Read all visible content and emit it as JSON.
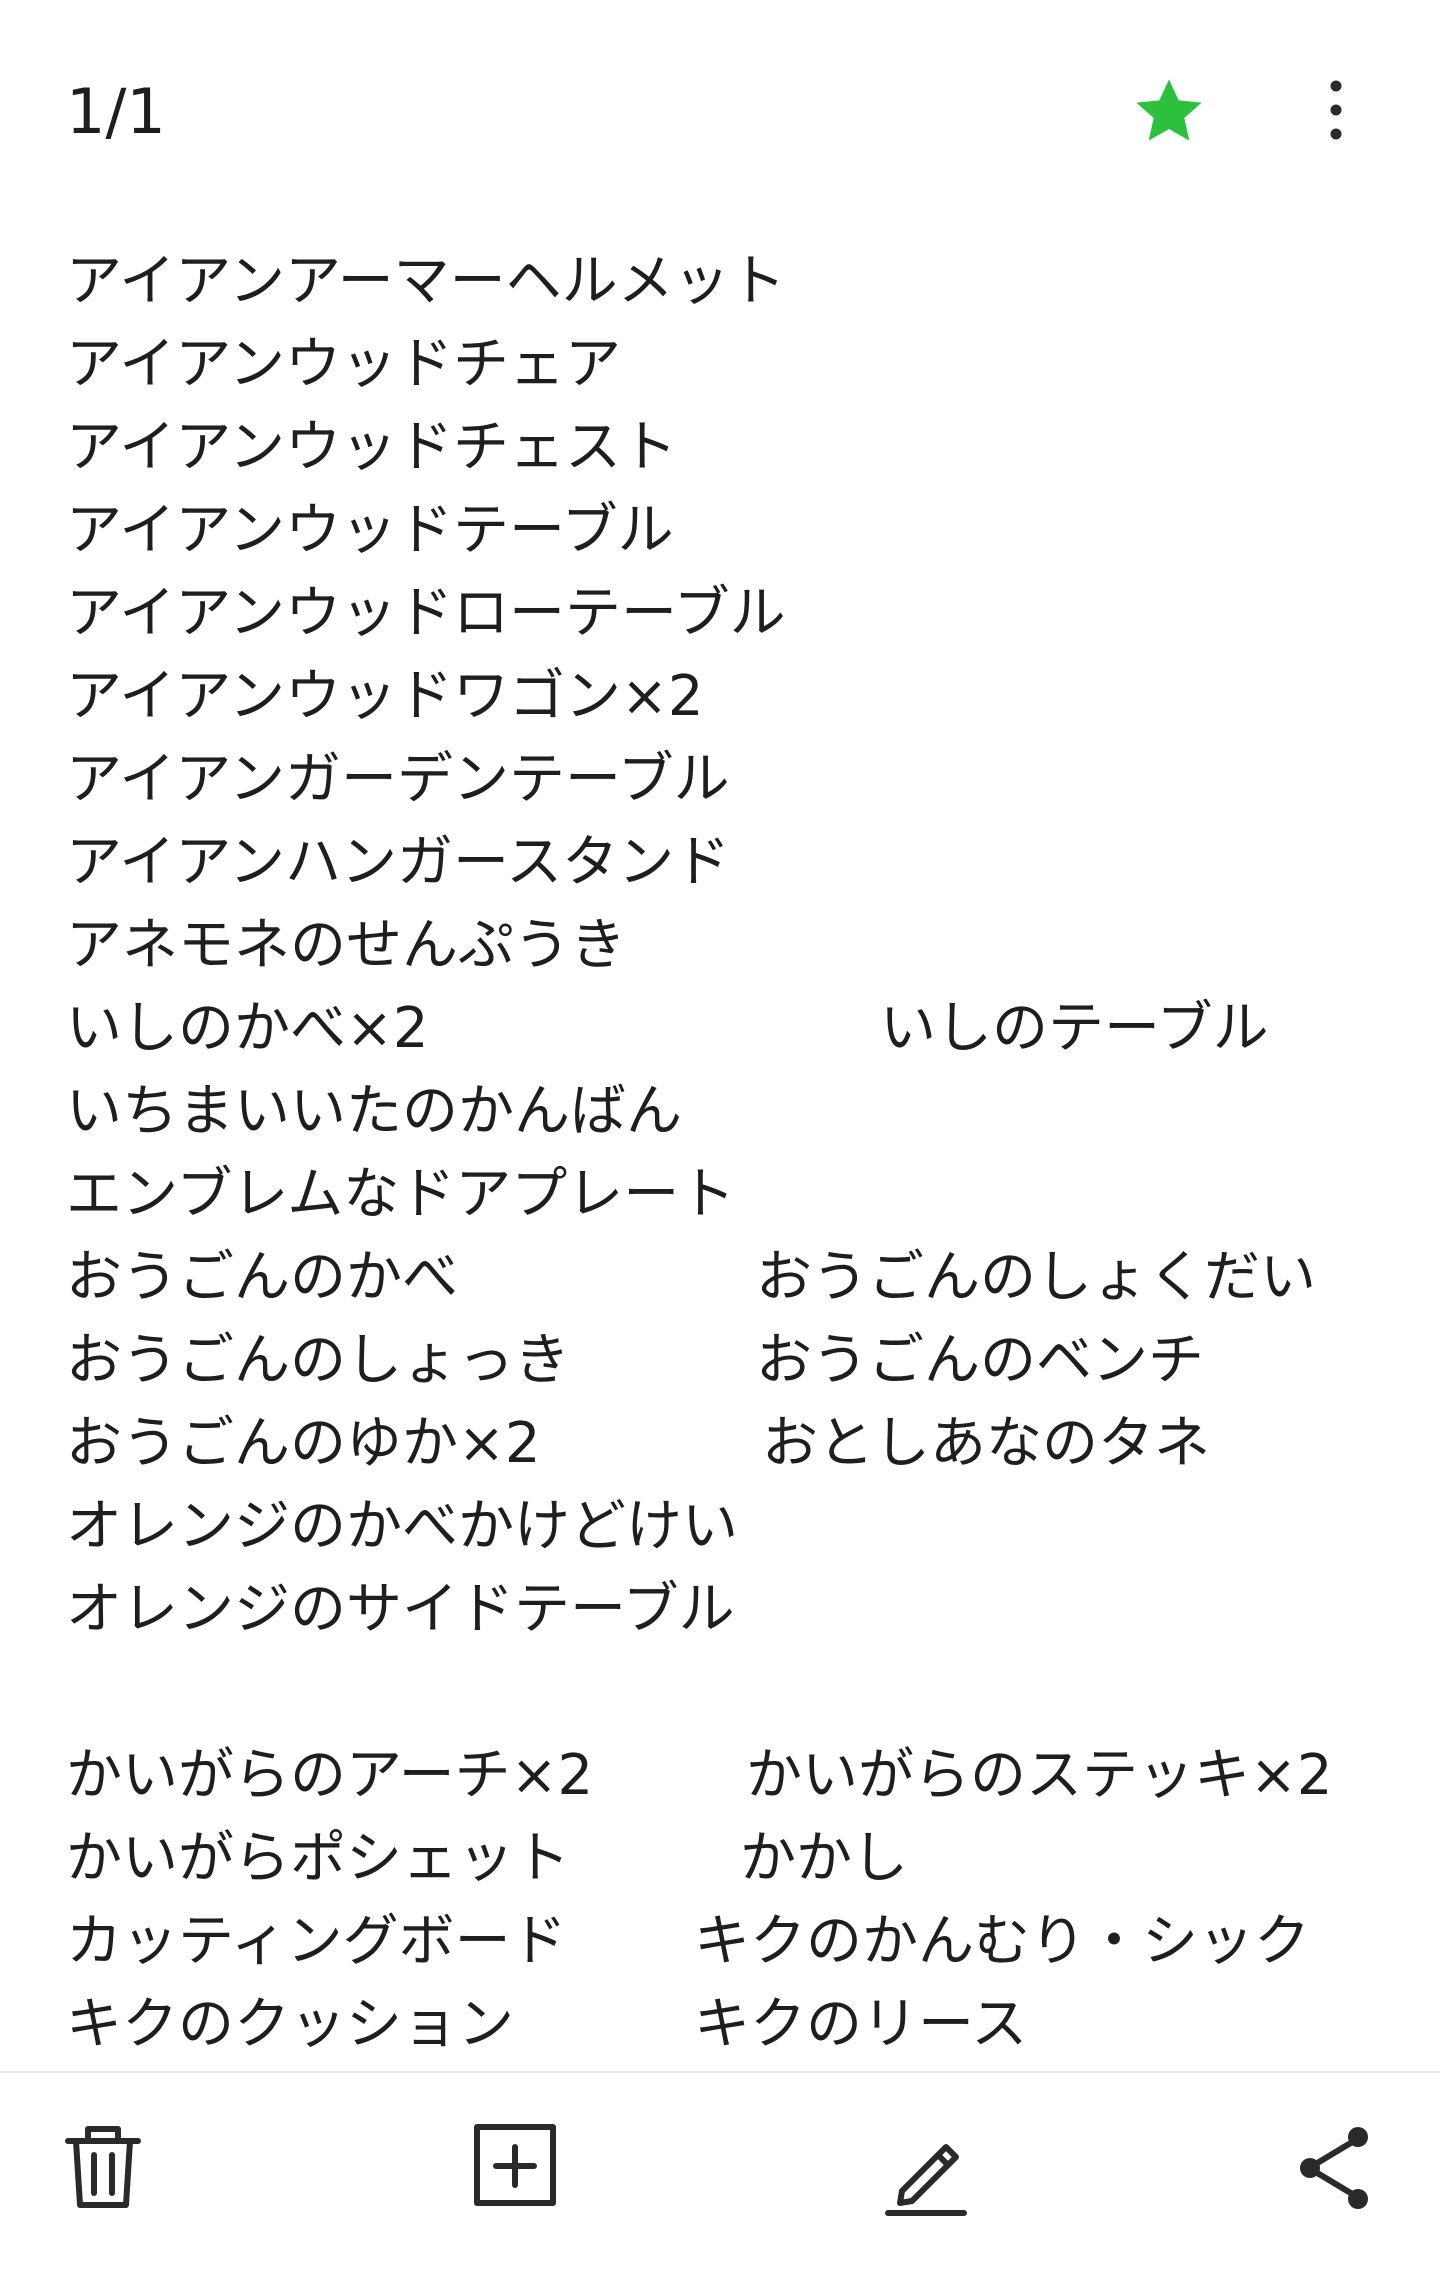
{
  "header": {
    "page_counter": "1/1",
    "favorite_icon": "star-icon",
    "more_icon": "more-vertical-icon",
    "accent_color": "#2cc03d"
  },
  "note": {
    "lines": [
      {
        "col1": "アイアンアーマーヘルメット"
      },
      {
        "col1": "アイアンウッドチェア"
      },
      {
        "col1": "アイアンウッドチェスト"
      },
      {
        "col1": "アイアンウッドテーブル"
      },
      {
        "col1": "アイアンウッドローテーブル"
      },
      {
        "col1": "アイアンウッドワゴン×2"
      },
      {
        "col1": "アイアンガーデンテーブル"
      },
      {
        "col1": "アイアンハンガースタンド"
      },
      {
        "col1": "アネモネのせんぷうき"
      },
      {
        "col1": "いしのかべ×2",
        "col2": "いしのテーブル"
      },
      {
        "col1": "いちまいいたのかんばん"
      },
      {
        "col1": "エンブレムなドアプレート"
      },
      {
        "col1": "おうごんのかべ",
        "col2": "おうごんのしょくだい"
      },
      {
        "col1": "おうごんのしょっき",
        "col2": "おうごんのベンチ"
      },
      {
        "col1": "おうごんのゆか×2",
        "col2": "おとしあなのタネ"
      },
      {
        "col1": "オレンジのかべかけどけい"
      },
      {
        "col1": "オレンジのサイドテーブル"
      },
      {
        "col1": ""
      },
      {
        "col1": "かいがらのアーチ×2",
        "col2": "かいがらのステッキ×2"
      },
      {
        "col1": "かいがらポシェット",
        "col2": "かかし"
      },
      {
        "col1": "カッティングボード",
        "col2": "キクのかんむり・シック"
      },
      {
        "col1": "キクのクッション",
        "col2": "キクのリース"
      }
    ]
  },
  "toolbar": {
    "delete_icon": "trash-icon",
    "add_icon": "add-box-icon",
    "edit_icon": "edit-pencil-icon",
    "share_icon": "share-icon"
  }
}
